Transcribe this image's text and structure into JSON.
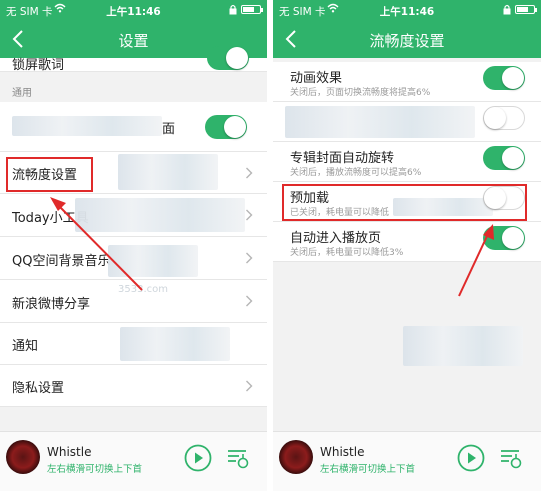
{
  "status": {
    "carrier": "无 SIM 卡",
    "time": "上午11:46"
  },
  "colors": {
    "accent": "#2fb36b",
    "highlight": "#e02a2a",
    "toggle_off": "#ffffff"
  },
  "left": {
    "title": "设置",
    "top_partial_label": "锁屏歌词",
    "section_general": "通用",
    "partial_row_suffix": "面",
    "items": [
      {
        "label": "流畅度设置"
      },
      {
        "label": "Today小工具"
      },
      {
        "label": "QQ空间背景音乐"
      },
      {
        "label": "新浪微博分享"
      },
      {
        "label": "通知"
      },
      {
        "label": "隐私设置"
      }
    ],
    "toggles": {
      "lyrics_on": true,
      "general_row_on": true
    }
  },
  "right": {
    "title": "流畅度设置",
    "items": [
      {
        "label": "动画效果",
        "desc": "关闭后，页面切换流畅度将提高6%",
        "on": true
      },
      {
        "label": "",
        "desc": "",
        "on": false
      },
      {
        "label": "专辑封面自动旋转",
        "desc": "关闭后，播放流畅度可以提高6%",
        "on": true
      },
      {
        "label": "预加载",
        "desc": "已关闭，耗电量可以降低",
        "on": false
      },
      {
        "label": "自动进入播放页",
        "desc": "关闭后，耗电量可以降低3%",
        "on": true
      }
    ]
  },
  "player": {
    "song": "Whistle",
    "hint": "左右横滑可切换上下首",
    "icons": {
      "play": "play-circle-icon",
      "queue": "playlist-icon"
    }
  },
  "watermark": "3533.com"
}
